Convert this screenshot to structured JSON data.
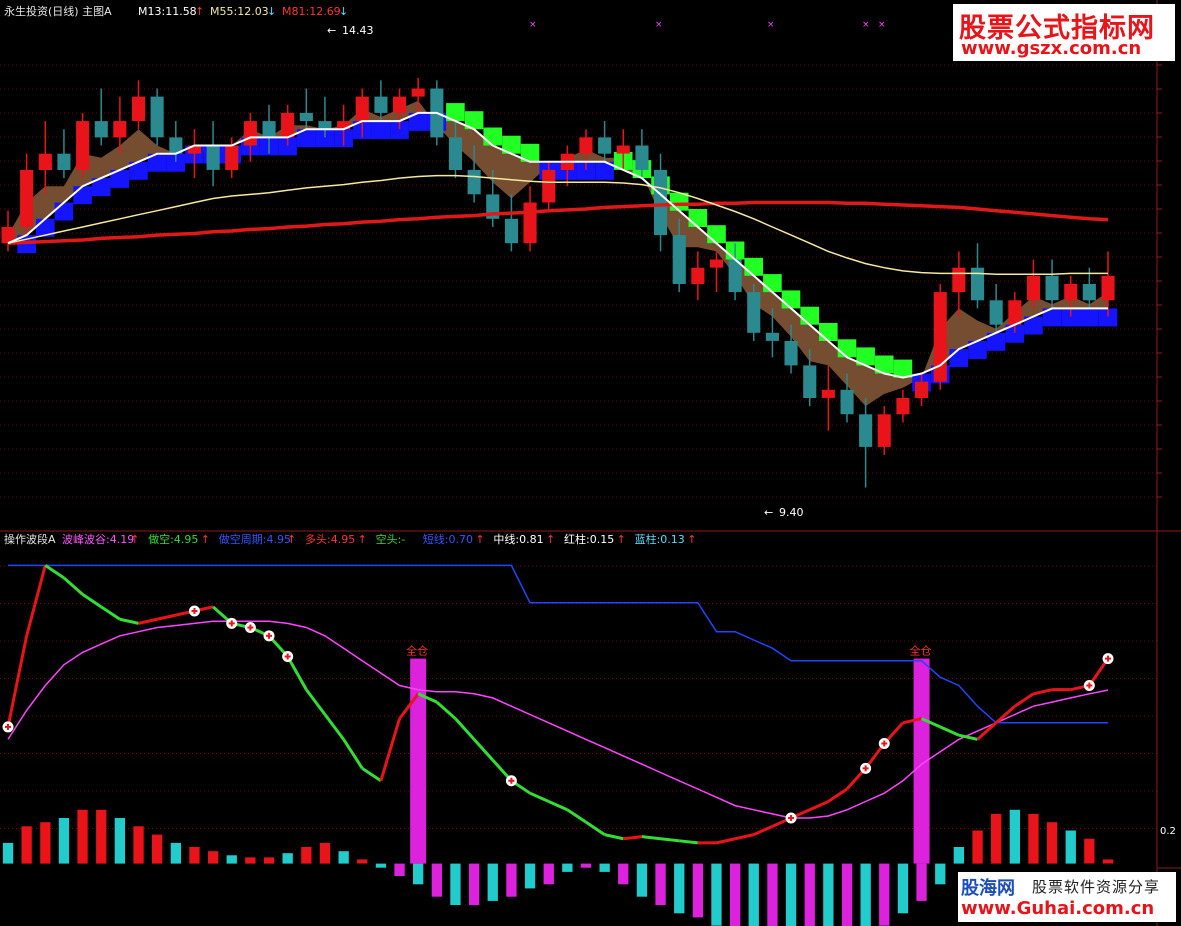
{
  "header_top": {
    "name": "永生投资(日线) 主图A",
    "m13": "M13:11.58",
    "m55": "M55:12.03",
    "m81": "M81:12.69"
  },
  "header_bottom": {
    "name": "操作波段A",
    "items": [
      {
        "text": "波峰波谷:4.19",
        "color": "#ff55ff"
      },
      {
        "text": "做空:4.95",
        "color": "#33dd33"
      },
      {
        "text": "做空周期:4.95",
        "color": "#3355ff"
      },
      {
        "text": "多头:4.95",
        "color": "#ff3333"
      },
      {
        "text": "空头:-",
        "color": "#33dd33"
      },
      {
        "text": "短线:0.70",
        "color": "#3355ff"
      },
      {
        "text": "中线:0.81",
        "color": "#ffffff"
      },
      {
        "text": "红柱:0.15",
        "color": "#ffffff"
      },
      {
        "text": "蓝柱:0.13",
        "color": "#55ddff"
      }
    ]
  },
  "annotations": {
    "high": "14.43",
    "low": "9.40",
    "signal": "全仓",
    "last_value": "0.2"
  },
  "watermark_top": {
    "title": "股票公式指标网",
    "url": "www.gszx.com.cn"
  },
  "watermark_bottom": {
    "brand": "股海网",
    "slogan": "股票软件资源分享",
    "url": "www.Guhai.com.cn"
  },
  "colors": {
    "up": "#e8141a",
    "down": "#2a8a90",
    "ma13": "#ffffff",
    "ma55": "#f5e8a0",
    "ma81": "#e01818",
    "ribbon": "#8a5a3a",
    "bull_band": "#1414ff",
    "bear_band": "#22ff22"
  },
  "chart_data": [
    {
      "type": "candlestick",
      "title": "永生投资(日线) 主图A",
      "ylim": [
        9.1,
        14.65
      ],
      "high_label": 14.43,
      "low_label": 9.4,
      "candles": [
        [
          12.4,
          12.8,
          12.3,
          12.6
        ],
        [
          12.6,
          13.5,
          12.5,
          13.3
        ],
        [
          13.3,
          13.9,
          13.0,
          13.5
        ],
        [
          13.5,
          13.8,
          13.2,
          13.3
        ],
        [
          13.3,
          14.0,
          13.2,
          13.9
        ],
        [
          13.9,
          14.3,
          13.6,
          13.7
        ],
        [
          13.7,
          14.2,
          13.5,
          13.9
        ],
        [
          13.9,
          14.4,
          13.8,
          14.2
        ],
        [
          14.2,
          14.3,
          13.6,
          13.7
        ],
        [
          13.7,
          13.9,
          13.4,
          13.5
        ],
        [
          13.5,
          13.8,
          13.2,
          13.6
        ],
        [
          13.6,
          13.9,
          13.1,
          13.3
        ],
        [
          13.3,
          13.7,
          13.2,
          13.6
        ],
        [
          13.6,
          14.0,
          13.4,
          13.9
        ],
        [
          13.9,
          14.1,
          13.5,
          13.7
        ],
        [
          13.7,
          14.1,
          13.6,
          14.0
        ],
        [
          14.0,
          14.3,
          13.8,
          13.9
        ],
        [
          13.9,
          14.2,
          13.7,
          13.8
        ],
        [
          13.8,
          14.1,
          13.6,
          13.9
        ],
        [
          13.9,
          14.3,
          13.7,
          14.2
        ],
        [
          14.2,
          14.4,
          13.9,
          14.0
        ],
        [
          14.0,
          14.3,
          13.8,
          14.2
        ],
        [
          14.2,
          14.43,
          14.0,
          14.3
        ],
        [
          14.3,
          14.4,
          13.6,
          13.7
        ],
        [
          13.7,
          13.9,
          13.2,
          13.3
        ],
        [
          13.3,
          13.6,
          12.9,
          13.0
        ],
        [
          13.0,
          13.3,
          12.6,
          12.7
        ],
        [
          12.7,
          13.0,
          12.3,
          12.4
        ],
        [
          12.4,
          13.1,
          12.3,
          12.9
        ],
        [
          12.9,
          13.4,
          12.8,
          13.3
        ],
        [
          13.3,
          13.6,
          13.1,
          13.5
        ],
        [
          13.5,
          13.8,
          13.3,
          13.7
        ],
        [
          13.7,
          13.9,
          13.4,
          13.5
        ],
        [
          13.5,
          13.8,
          13.3,
          13.6
        ],
        [
          13.6,
          13.8,
          13.2,
          13.3
        ],
        [
          13.3,
          13.5,
          12.3,
          12.5
        ],
        [
          12.5,
          12.7,
          11.8,
          11.9
        ],
        [
          11.9,
          12.3,
          11.7,
          12.1
        ],
        [
          12.1,
          12.3,
          11.8,
          12.2
        ],
        [
          12.2,
          12.4,
          11.7,
          11.8
        ],
        [
          11.8,
          11.9,
          11.2,
          11.3
        ],
        [
          11.3,
          11.6,
          11.0,
          11.2
        ],
        [
          11.2,
          11.4,
          10.8,
          10.9
        ],
        [
          10.9,
          11.1,
          10.4,
          10.5
        ],
        [
          10.5,
          10.9,
          10.1,
          10.6
        ],
        [
          10.6,
          10.8,
          10.2,
          10.3
        ],
        [
          10.3,
          10.5,
          9.4,
          9.9
        ],
        [
          9.9,
          10.4,
          9.8,
          10.3
        ],
        [
          10.3,
          10.6,
          10.2,
          10.5
        ],
        [
          10.5,
          10.8,
          10.4,
          10.7
        ],
        [
          10.7,
          11.9,
          10.6,
          11.8
        ],
        [
          11.8,
          12.3,
          11.5,
          12.1
        ],
        [
          12.1,
          12.4,
          11.6,
          11.7
        ],
        [
          11.7,
          11.9,
          11.3,
          11.4
        ],
        [
          11.4,
          11.8,
          11.3,
          11.7
        ],
        [
          11.7,
          12.2,
          11.6,
          12.0
        ],
        [
          12.0,
          12.2,
          11.6,
          11.7
        ],
        [
          11.7,
          12.0,
          11.5,
          11.9
        ],
        [
          11.9,
          12.1,
          11.6,
          11.7
        ],
        [
          11.7,
          12.3,
          11.5,
          12.0
        ]
      ],
      "ma13": [
        12.4,
        12.5,
        12.7,
        12.9,
        13.1,
        13.2,
        13.3,
        13.4,
        13.5,
        13.5,
        13.6,
        13.6,
        13.6,
        13.7,
        13.7,
        13.7,
        13.8,
        13.8,
        13.8,
        13.9,
        13.9,
        13.9,
        14.0,
        14.0,
        13.9,
        13.8,
        13.6,
        13.5,
        13.4,
        13.4,
        13.4,
        13.4,
        13.4,
        13.3,
        13.2,
        13.0,
        12.8,
        12.6,
        12.4,
        12.2,
        12.0,
        11.8,
        11.6,
        11.4,
        11.2,
        11.0,
        10.9,
        10.8,
        10.75,
        10.8,
        10.9,
        11.1,
        11.2,
        11.3,
        11.4,
        11.5,
        11.6,
        11.6,
        11.6,
        11.6
      ],
      "ma55": [
        12.4,
        12.45,
        12.5,
        12.55,
        12.6,
        12.65,
        12.7,
        12.75,
        12.8,
        12.85,
        12.9,
        12.95,
        12.98,
        13.0,
        13.02,
        13.05,
        13.08,
        13.1,
        13.12,
        13.15,
        13.17,
        13.2,
        13.22,
        13.23,
        13.23,
        13.22,
        13.2,
        13.18,
        13.16,
        13.15,
        13.15,
        13.15,
        13.15,
        13.14,
        13.12,
        13.08,
        13.02,
        12.95,
        12.87,
        12.79,
        12.7,
        12.6,
        12.5,
        12.4,
        12.3,
        12.22,
        12.15,
        12.1,
        12.06,
        12.04,
        12.03,
        12.03,
        12.03,
        12.02,
        12.02,
        12.02,
        12.02,
        12.03,
        12.03,
        12.03
      ],
      "ma81": [
        12.4,
        12.41,
        12.42,
        12.43,
        12.44,
        12.46,
        12.47,
        12.48,
        12.5,
        12.51,
        12.52,
        12.54,
        12.55,
        12.57,
        12.58,
        12.6,
        12.61,
        12.63,
        12.64,
        12.66,
        12.67,
        12.69,
        12.7,
        12.72,
        12.73,
        12.74,
        12.76,
        12.77,
        12.78,
        12.8,
        12.81,
        12.82,
        12.84,
        12.85,
        12.86,
        12.87,
        12.88,
        12.88,
        12.89,
        12.89,
        12.9,
        12.9,
        12.9,
        12.9,
        12.9,
        12.89,
        12.89,
        12.88,
        12.87,
        12.86,
        12.85,
        12.84,
        12.82,
        12.8,
        12.78,
        12.76,
        12.74,
        12.72,
        12.7,
        12.69
      ]
    },
    {
      "type": "line",
      "title": "操作波段A",
      "ylim": [
        -1.0,
        7.5
      ],
      "series": [
        {
          "name": "波峰波谷",
          "color": "#ff44ff",
          "values": [
            3.0,
            3.7,
            4.3,
            4.8,
            5.1,
            5.3,
            5.5,
            5.6,
            5.7,
            5.75,
            5.8,
            5.85,
            5.85,
            5.85,
            5.85,
            5.8,
            5.7,
            5.5,
            5.2,
            4.9,
            4.6,
            4.3,
            4.2,
            4.15,
            4.15,
            4.1,
            4.0,
            3.8,
            3.6,
            3.4,
            3.2,
            3.0,
            2.8,
            2.6,
            2.4,
            2.2,
            2.0,
            1.8,
            1.6,
            1.4,
            1.3,
            1.2,
            1.1,
            1.1,
            1.15,
            1.3,
            1.5,
            1.7,
            2.0,
            2.4,
            2.7,
            3.0,
            3.2,
            3.4,
            3.6,
            3.8,
            3.9,
            4.0,
            4.1,
            4.19
          ]
        },
        {
          "name": "做空周期",
          "color": "#2244ff",
          "values": [
            7.2,
            7.2,
            7.2,
            7.2,
            7.2,
            7.2,
            7.2,
            7.2,
            7.2,
            7.2,
            7.2,
            7.2,
            7.2,
            7.2,
            7.2,
            7.2,
            7.2,
            7.2,
            7.2,
            7.2,
            7.2,
            7.2,
            7.2,
            7.2,
            7.2,
            7.2,
            7.2,
            7.2,
            6.3,
            6.3,
            6.3,
            6.3,
            6.3,
            6.3,
            6.3,
            6.3,
            6.3,
            6.3,
            5.6,
            5.6,
            5.4,
            5.2,
            4.9,
            4.9,
            4.9,
            4.9,
            4.9,
            4.9,
            4.9,
            4.9,
            4.5,
            4.3,
            3.8,
            3.4,
            3.4,
            3.4,
            3.4,
            3.4,
            3.4,
            3.4
          ]
        },
        {
          "name": "多空线",
          "values": [
            3.3,
            5.5,
            7.2,
            6.9,
            6.5,
            6.2,
            5.9,
            5.8,
            5.9,
            6.0,
            6.1,
            6.2,
            5.8,
            5.7,
            5.5,
            5.0,
            4.2,
            3.6,
            3.0,
            2.3,
            2.0,
            3.5,
            4.1,
            3.9,
            3.5,
            3.0,
            2.5,
            2.0,
            1.7,
            1.5,
            1.3,
            1.0,
            0.7,
            0.6,
            0.65,
            0.6,
            0.55,
            0.5,
            0.5,
            0.6,
            0.7,
            0.9,
            1.1,
            1.3,
            1.5,
            1.8,
            2.3,
            2.9,
            3.4,
            3.5,
            3.3,
            3.1,
            3.0,
            3.4,
            3.8,
            4.1,
            4.2,
            4.2,
            4.3,
            4.95
          ]
        }
      ],
      "signals": [
        22,
        49
      ],
      "bars": [
        0.5,
        0.9,
        1.0,
        1.1,
        1.3,
        1.3,
        1.1,
        0.9,
        0.7,
        0.5,
        0.4,
        0.3,
        0.2,
        0.15,
        0.15,
        0.25,
        0.4,
        0.5,
        0.3,
        0.1,
        -0.1,
        -0.3,
        -0.5,
        -0.8,
        -1.0,
        -1.0,
        -0.9,
        -0.8,
        -0.6,
        -0.5,
        -0.2,
        -0.1,
        -0.2,
        -0.5,
        -0.8,
        -1.0,
        -1.2,
        -1.3,
        -1.5,
        -1.6,
        -1.7,
        -1.8,
        -1.8,
        -1.9,
        -1.95,
        -1.9,
        -1.7,
        -1.5,
        -1.2,
        -0.9,
        -0.5,
        0.4,
        0.8,
        1.2,
        1.3,
        1.2,
        1.0,
        0.8,
        0.6,
        0.1
      ]
    }
  ]
}
